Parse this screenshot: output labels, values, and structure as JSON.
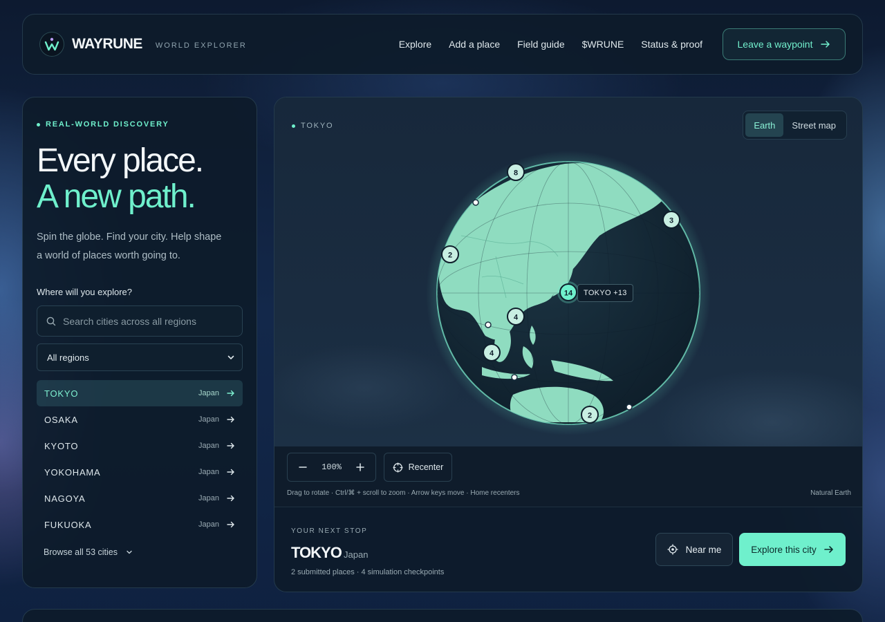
{
  "header": {
    "brand": "WAYRUNE",
    "tagline": "WORLD EXPLORER",
    "nav": [
      "Explore",
      "Add a place",
      "Field guide",
      "$WRUNE",
      "Status & proof"
    ],
    "cta_label": "Leave a waypoint"
  },
  "sidebar": {
    "eyebrow": "REAL-WORLD DISCOVERY",
    "hero_line1": "Every place.",
    "hero_line2": "A new path.",
    "subtitle_line1": "Spin the globe. Find your city. Help shape",
    "subtitle_line2": "a world of places worth going to.",
    "question": "Where will you explore?",
    "search_placeholder": "Search cities across all regions",
    "region_selected": "All regions",
    "cities": [
      {
        "name": "TOKYO",
        "country": "Japan"
      },
      {
        "name": "OSAKA",
        "country": "Japan"
      },
      {
        "name": "KYOTO",
        "country": "Japan"
      },
      {
        "name": "YOKOHAMA",
        "country": "Japan"
      },
      {
        "name": "NAGOYA",
        "country": "Japan"
      },
      {
        "name": "FUKUOKA",
        "country": "Japan"
      }
    ],
    "browse_label": "Browse all 53 cities"
  },
  "map": {
    "location_label": "TOKYO",
    "view_options": [
      "Earth",
      "Street map"
    ],
    "active_view": "Earth",
    "clusters": [
      "8",
      "3",
      "2",
      "14",
      "4",
      "4",
      "2"
    ],
    "tooltip": "TOKYO +13",
    "zoom": "100%",
    "recenter_label": "Recenter",
    "hint": "Drag to rotate · Ctrl/⌘ + scroll to zoom · Arrow keys move · Home recenters",
    "source": "Natural Earth"
  },
  "next_stop": {
    "eyebrow": "YOUR NEXT STOP",
    "city": "TOKYO",
    "country": "Japan",
    "meta": "2 submitted places · 4 simulation checkpoints",
    "near_label": "Near me",
    "explore_label": "Explore this city"
  },
  "colors": {
    "accent": "#6ff0cc",
    "panel": "#0d1b2a",
    "land": "#8fdcc0",
    "ocean": "#142635"
  }
}
